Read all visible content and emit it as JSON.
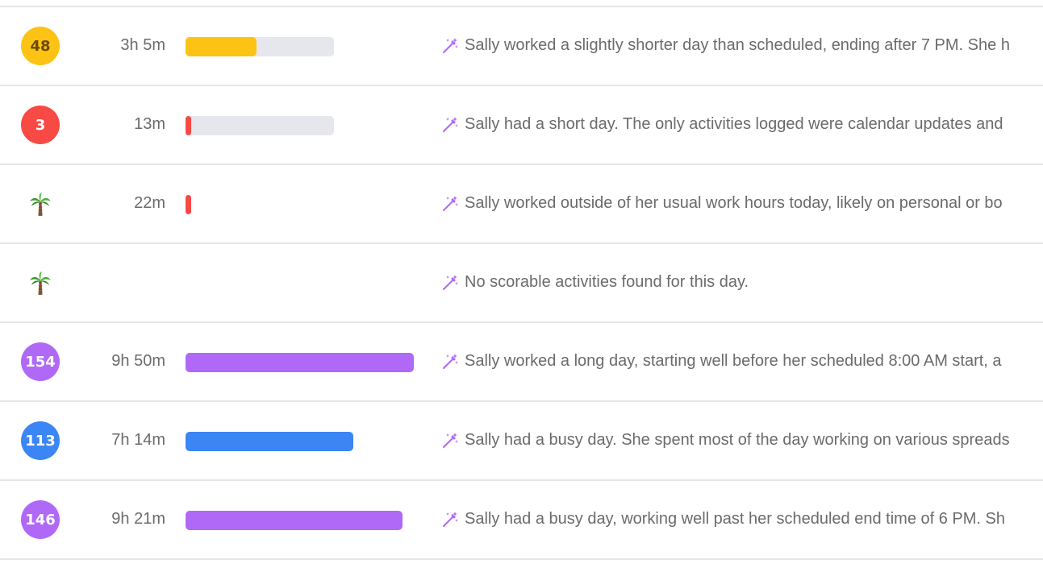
{
  "colors": {
    "yellow": "#fcc314",
    "red": "#f84a45",
    "purple": "#b069f7",
    "blue": "#3c85f5",
    "track": "#e6e7ec",
    "wand": "#b069f7"
  },
  "rows": [
    {
      "score": "48",
      "badge_color": "yellow",
      "duration": "3h 5m",
      "bar": {
        "track": true,
        "fill_fraction": 0.48,
        "color": "yellow"
      },
      "summary": "Sally worked a slightly shorter day than scheduled, ending after 7 PM. She h"
    },
    {
      "score": "3",
      "badge_color": "red",
      "duration": "13m",
      "bar": {
        "track": true,
        "fill_fraction": 0.03,
        "color": "red"
      },
      "summary": "Sally had a short day. The only activities logged were calendar updates and"
    },
    {
      "icon": "palm-tree-icon",
      "duration": "22m",
      "bar": {
        "track": false,
        "fill_fraction": 0.04,
        "color": "red"
      },
      "summary": "Sally worked outside of her usual work hours today, likely on personal or bo"
    },
    {
      "icon": "palm-tree-icon",
      "duration": "",
      "bar": null,
      "summary": "No scorable activities found for this day."
    },
    {
      "score": "154",
      "badge_color": "purple",
      "duration": "9h 50m",
      "bar": {
        "track": false,
        "fill_fraction": 1.54,
        "color": "purple"
      },
      "summary": "Sally worked a long day, starting well before her scheduled 8:00 AM start, a"
    },
    {
      "score": "113",
      "badge_color": "blue",
      "duration": "7h 14m",
      "bar": {
        "track": false,
        "fill_fraction": 1.13,
        "color": "blue"
      },
      "summary": "Sally had a busy day. She spent most of the day working on various spreads"
    },
    {
      "score": "146",
      "badge_color": "purple",
      "duration": "9h 21m",
      "bar": {
        "track": false,
        "fill_fraction": 1.46,
        "color": "purple"
      },
      "summary": "Sally had a busy day, working well past her scheduled end time of 6 PM. Sh"
    }
  ]
}
